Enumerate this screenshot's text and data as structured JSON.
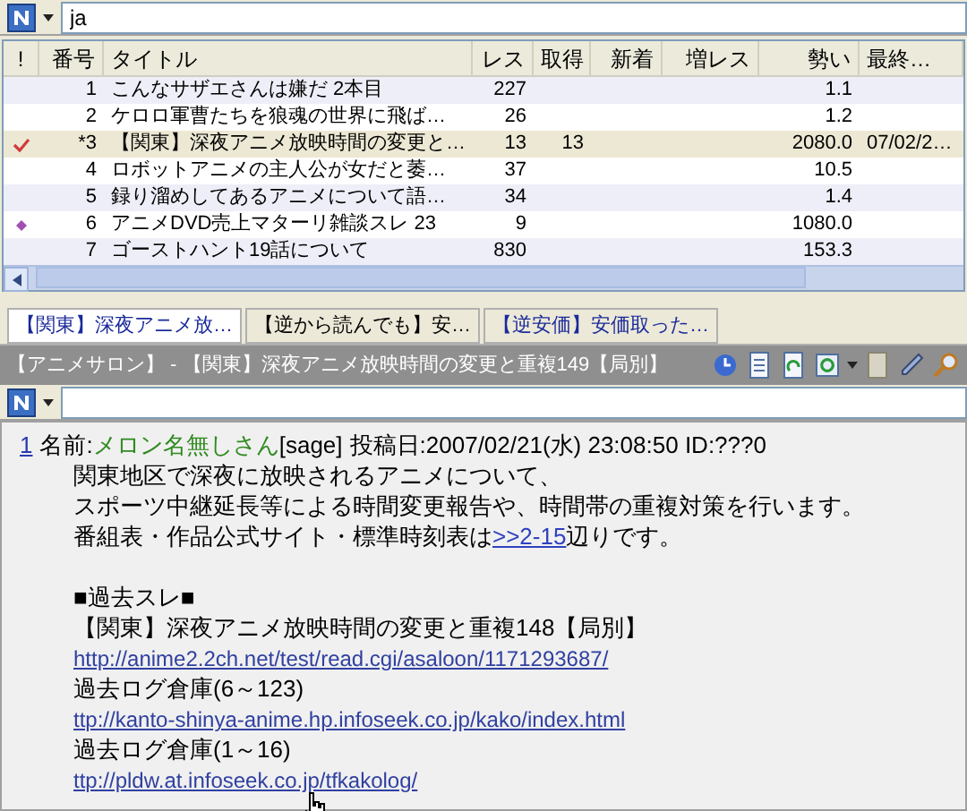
{
  "top_filter": {
    "value": "ja"
  },
  "table": {
    "columns": [
      {
        "label": "!"
      },
      {
        "label": "番号"
      },
      {
        "label": "タイトル"
      },
      {
        "label": "レス"
      },
      {
        "label": "取得"
      },
      {
        "label": "新着"
      },
      {
        "label": "増レス"
      },
      {
        "label": "勢い"
      },
      {
        "label": "最終…"
      }
    ],
    "rows": [
      {
        "kind": "plain",
        "number": "1",
        "title": "こんなサザエさんは嫌だ 2本目",
        "res": "227",
        "got": "",
        "speed": "1.1",
        "last": "",
        "selected": false
      },
      {
        "kind": "plain",
        "number": "2",
        "title": "ケロロ軍曹たちを狼魂の世界に飛ば…",
        "res": "26",
        "got": "",
        "speed": "1.2",
        "last": "",
        "selected": false
      },
      {
        "kind": "checked",
        "number": "*3",
        "title": "【関東】深夜アニメ放映時間の変更と…",
        "res": "13",
        "got": "13",
        "speed": "2080.0",
        "last": "07/02/2…",
        "selected": true
      },
      {
        "kind": "plain",
        "number": "4",
        "title": "ロボットアニメの主人公が女だと萎…",
        "res": "37",
        "got": "",
        "speed": "10.5",
        "last": "",
        "selected": false
      },
      {
        "kind": "plain",
        "number": "5",
        "title": "録り溜めしてあるアニメについて語…",
        "res": "34",
        "got": "",
        "speed": "1.4",
        "last": "",
        "selected": false
      },
      {
        "kind": "marked",
        "number": "6",
        "title": "アニメDVD売上マターリ雑談スレ 23",
        "res": "9",
        "got": "",
        "speed": "1080.0",
        "last": "",
        "selected": false
      },
      {
        "kind": "plain",
        "number": "7",
        "title": "ゴーストハント19話について",
        "res": "830",
        "got": "",
        "speed": "153.3",
        "last": "",
        "selected": false
      }
    ]
  },
  "tabs": [
    {
      "label": "【関東】深夜アニメ放…",
      "selected": true,
      "unread": true
    },
    {
      "label": "【逆から読んでも】安…",
      "selected": false,
      "unread": false
    },
    {
      "label": "【逆安価】安価取った…",
      "selected": false,
      "unread": true
    }
  ],
  "thread_title": "【アニメサロン】 - 【関東】深夜アニメ放映時間の変更と重複149【局別】",
  "post": {
    "number": "1",
    "name_label": "名前:",
    "name": "メロン名無しさん",
    "mail": "[sage]",
    "meta": "投稿日:2007/02/21(水) 23:08:50 ID:???0",
    "lines": [
      {
        "kind": "text",
        "text": "関東地区で深夜に放映されるアニメについて、"
      },
      {
        "kind": "text",
        "text": "スポーツ中継延長等による時間変更報告や、時間帯の重複対策を行います。"
      },
      {
        "kind": "anchor",
        "before": "番組表・作品公式サイト・標準時刻表は",
        "link": ">>2-15",
        "after": "辺りです。"
      },
      {
        "kind": "blank"
      },
      {
        "kind": "text",
        "text": "■過去スレ■"
      },
      {
        "kind": "text",
        "text": "【関東】深夜アニメ放映時間の変更と重複148【局別】"
      },
      {
        "kind": "link",
        "text": "http://anime2.2ch.net/test/read.cgi/asaloon/1171293687/"
      },
      {
        "kind": "text",
        "text": "過去ログ倉庫(6～123)"
      },
      {
        "kind": "link",
        "text": "ttp://kanto-shinya-anime.hp.infoseek.co.jp/kako/index.html"
      },
      {
        "kind": "text",
        "text": "過去ログ倉庫(1～16)"
      },
      {
        "kind": "link",
        "text": "ttp://pldw.at.infoseek.co.jp/tfkakolog/",
        "hovered": true
      }
    ]
  }
}
